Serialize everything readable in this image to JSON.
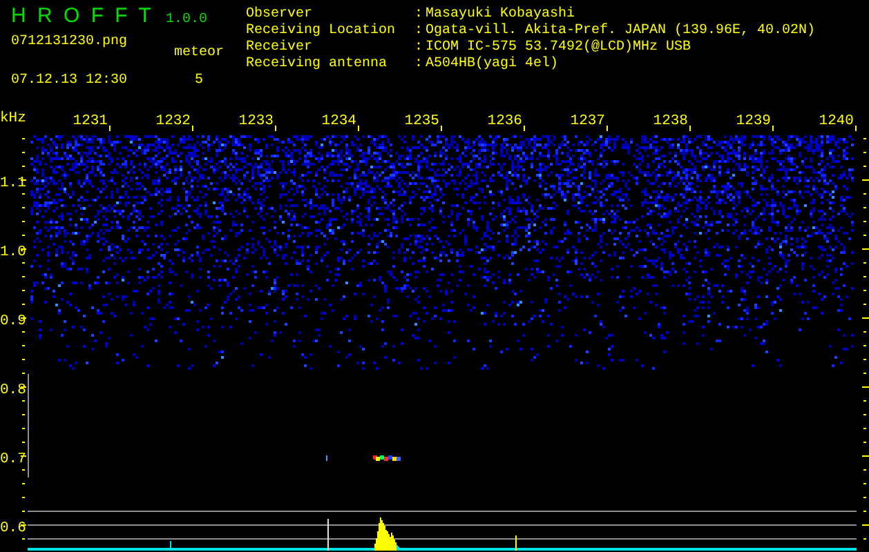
{
  "app": {
    "name": "H R O F F T",
    "version": "1.0.0"
  },
  "file": {
    "filename": "0712131230.png",
    "datetime": "07.12.13 12:30",
    "meteor_label": "meteor",
    "meteor_count": "5"
  },
  "info": [
    {
      "label": "Observer",
      "separator": ":",
      "value": "Masayuki Kobayashi"
    },
    {
      "label": "Receiving Location",
      "separator": ":",
      "value": "Ogata-vill. Akita-Pref. JAPAN (139.96E, 40.02N)"
    },
    {
      "label": "Receiver",
      "separator": ":",
      "value": "ICOM IC-575 53.7492(@LCD)MHz USB"
    },
    {
      "label": "Receiving antenna",
      "separator": ":",
      "value": "A504HB(yagi 4el)"
    }
  ],
  "spectrogram": {
    "unit": "kHz",
    "time_labels": [
      "1231",
      "1232",
      "1233",
      "1234",
      "1235",
      "1236",
      "1237",
      "1238",
      "1239",
      "1240"
    ],
    "freq_labels": [
      "1.1",
      "1.0",
      "0.9",
      "0.8",
      "0.7",
      "0.6"
    ]
  }
}
